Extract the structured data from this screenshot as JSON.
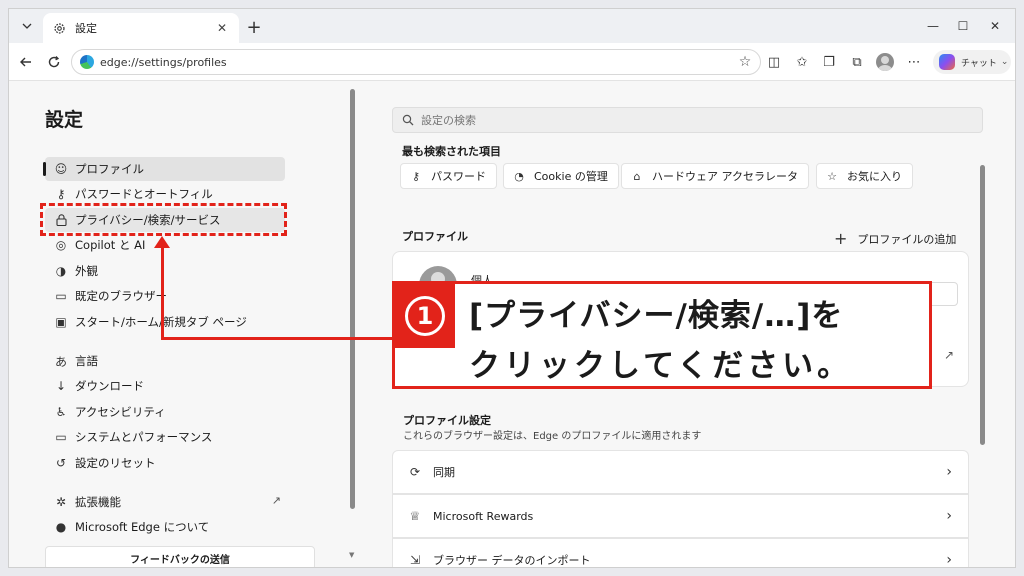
{
  "tab": {
    "title": "設定",
    "close_label": "✕",
    "new_tab_label": "+"
  },
  "window_controls": {
    "minimize": "—",
    "maximize": "☐",
    "close": "✕"
  },
  "address_bar": {
    "url": "edge://settings/profiles"
  },
  "copilot": {
    "label": "チャット"
  },
  "sidebar": {
    "title": "設定",
    "items": [
      {
        "label": "プロファイル",
        "icon": "profile-icon",
        "glyph": "☺"
      },
      {
        "label": "パスワードとオートフィル",
        "icon": "key-icon",
        "glyph": "⚷"
      },
      {
        "label": "プライバシー/検索/サービス",
        "icon": "lock-icon",
        "glyph": "🔒︎"
      },
      {
        "label": "Copilot と AI",
        "icon": "copilot-icon",
        "glyph": "◎"
      },
      {
        "label": "外観",
        "icon": "appearance-icon",
        "glyph": "◑"
      },
      {
        "label": "既定のブラウザー",
        "icon": "browser-icon",
        "glyph": "▭"
      },
      {
        "label": "スタート/ホーム/新規タブ ページ",
        "icon": "home-icon",
        "glyph": "▣"
      },
      {
        "label": "言語",
        "icon": "language-icon",
        "glyph": "あ"
      },
      {
        "label": "ダウンロード",
        "icon": "download-icon",
        "glyph": "↓"
      },
      {
        "label": "アクセシビリティ",
        "icon": "accessibility-icon",
        "glyph": "♿︎"
      },
      {
        "label": "システムとパフォーマンス",
        "icon": "system-icon",
        "glyph": "▭"
      },
      {
        "label": "設定のリセット",
        "icon": "reset-icon",
        "glyph": "↺"
      },
      {
        "label": "拡張機能",
        "icon": "extensions-icon",
        "glyph": "✲"
      },
      {
        "label": "Microsoft Edge について",
        "icon": "edge-icon",
        "glyph": "●"
      }
    ],
    "feedback_label": "フィードバックの送信"
  },
  "search": {
    "placeholder": "設定の検索"
  },
  "most_searched": {
    "heading": "最も検索された項目",
    "chips": [
      {
        "label": "パスワード",
        "icon": "key-icon",
        "glyph": "⚷"
      },
      {
        "label": "Cookie の管理",
        "icon": "cookie-icon",
        "glyph": "◔"
      },
      {
        "label": "ハードウェア アクセラレータ",
        "icon": "hardware-icon",
        "glyph": "⌂"
      },
      {
        "label": "お気に入り",
        "icon": "favorites-icon",
        "glyph": "☆"
      }
    ]
  },
  "profiles": {
    "heading": "プロファイル",
    "add_label": "プロファイルの追加",
    "profile_name": "個人"
  },
  "profile_settings": {
    "heading": "プロファイル設定",
    "subtitle": "これらのブラウザー設定は、Edge のプロファイルに適用されます",
    "rows": [
      {
        "label": "同期",
        "icon": "sync-icon",
        "glyph": "⟳"
      },
      {
        "label": "Microsoft Rewards",
        "icon": "rewards-icon",
        "glyph": "♕"
      },
      {
        "label": "ブラウザー データのインポート",
        "icon": "import-icon",
        "glyph": "⇲"
      }
    ]
  },
  "annotation": {
    "step_number": "1",
    "line1": "[プライバシー/検索/…]を",
    "line2": "クリックしてください。",
    "color": "#e2231a"
  }
}
